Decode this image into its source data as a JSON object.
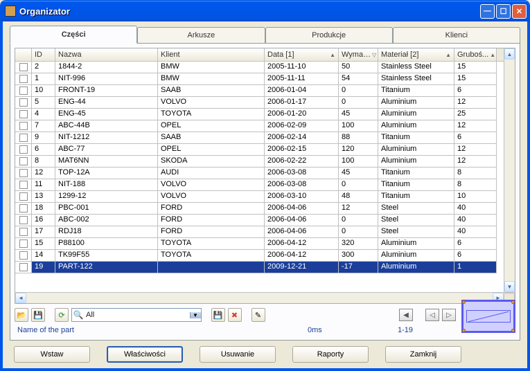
{
  "window": {
    "title": "Organizator"
  },
  "tabs": {
    "parts": "Części",
    "sheets": "Arkusze",
    "productions": "Produkcje",
    "clients": "Klienci"
  },
  "columns": {
    "id": "ID",
    "nazwa": "Nazwa",
    "klient": "Klient",
    "data": "Data [1]",
    "wyma": "Wyma…",
    "material": "Materiał [2]",
    "grubosc": "Gruboś..."
  },
  "rows": [
    {
      "id": "2",
      "nazwa": "1844-2",
      "klient": "BMW",
      "data": "2005-11-10",
      "wyma": "50",
      "mat": "Stainless Steel",
      "grub": "15"
    },
    {
      "id": "1",
      "nazwa": "NIT-996",
      "klient": "BMW",
      "data": "2005-11-11",
      "wyma": "54",
      "mat": "Stainless Steel",
      "grub": "15"
    },
    {
      "id": "10",
      "nazwa": "FRONT-19",
      "klient": "SAAB",
      "data": "2006-01-04",
      "wyma": "0",
      "mat": "Titanium",
      "grub": "6"
    },
    {
      "id": "5",
      "nazwa": "ENG-44",
      "klient": "VOLVO",
      "data": "2006-01-17",
      "wyma": "0",
      "mat": "Aluminium",
      "grub": "12"
    },
    {
      "id": "4",
      "nazwa": "ENG-45",
      "klient": "TOYOTA",
      "data": "2006-01-20",
      "wyma": "45",
      "mat": "Aluminium",
      "grub": "25"
    },
    {
      "id": "7",
      "nazwa": "ABC-44B",
      "klient": "OPEL",
      "data": "2006-02-09",
      "wyma": "100",
      "mat": "Aluminium",
      "grub": "12"
    },
    {
      "id": "9",
      "nazwa": "NIT-1212",
      "klient": "SAAB",
      "data": "2006-02-14",
      "wyma": "88",
      "mat": "Titanium",
      "grub": "6"
    },
    {
      "id": "6",
      "nazwa": "ABC-77",
      "klient": "OPEL",
      "data": "2006-02-15",
      "wyma": "120",
      "mat": "Aluminium",
      "grub": "12"
    },
    {
      "id": "8",
      "nazwa": "MAT6NN",
      "klient": "SKODA",
      "data": "2006-02-22",
      "wyma": "100",
      "mat": "Aluminium",
      "grub": "12"
    },
    {
      "id": "12",
      "nazwa": "TOP-12A",
      "klient": "AUDI",
      "data": "2006-03-08",
      "wyma": "45",
      "mat": "Titanium",
      "grub": "8"
    },
    {
      "id": "11",
      "nazwa": "NIT-188",
      "klient": "VOLVO",
      "data": "2006-03-08",
      "wyma": "0",
      "mat": "Titanium",
      "grub": "8"
    },
    {
      "id": "13",
      "nazwa": "1299-12",
      "klient": "VOLVO",
      "data": "2006-03-10",
      "wyma": "48",
      "mat": "Titanium",
      "grub": "10"
    },
    {
      "id": "18",
      "nazwa": "PBC-001",
      "klient": "FORD",
      "data": "2006-04-06",
      "wyma": "12",
      "mat": "Steel",
      "grub": "40"
    },
    {
      "id": "16",
      "nazwa": "ABC-002",
      "klient": "FORD",
      "data": "2006-04-06",
      "wyma": "0",
      "mat": "Steel",
      "grub": "40"
    },
    {
      "id": "17",
      "nazwa": "RDJ18",
      "klient": "FORD",
      "data": "2006-04-06",
      "wyma": "0",
      "mat": "Steel",
      "grub": "40"
    },
    {
      "id": "15",
      "nazwa": "P88100",
      "klient": "TOYOTA",
      "data": "2006-04-12",
      "wyma": "320",
      "mat": "Aluminium",
      "grub": "6"
    },
    {
      "id": "14",
      "nazwa": "TK99F55",
      "klient": "TOYOTA",
      "data": "2006-04-12",
      "wyma": "300",
      "mat": "Aluminium",
      "grub": "6"
    },
    {
      "id": "19",
      "nazwa": "PART-122",
      "klient": "",
      "data": "2009-12-21",
      "wyma": "-17",
      "mat": "Aluminium",
      "grub": "1",
      "selected": true
    }
  ],
  "search": {
    "text": "All"
  },
  "status": {
    "name": "Name of the part",
    "time": "0ms",
    "count": "1-19"
  },
  "buttons": {
    "insert": "Wstaw",
    "properties": "Właściwości",
    "delete": "Usuwanie",
    "reports": "Raporty",
    "close": "Zamknij"
  }
}
